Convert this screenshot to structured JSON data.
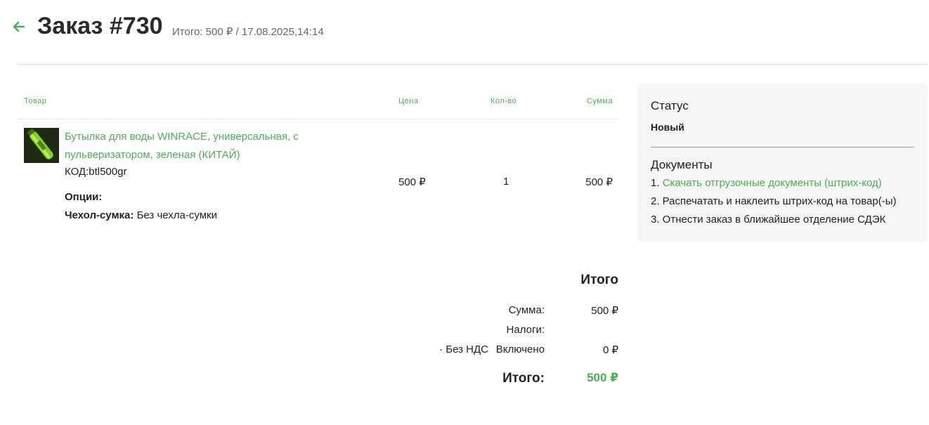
{
  "header": {
    "title": "Заказ #730",
    "subtitle": "Итого: 500 ₽ / 17.08.2025,14:14"
  },
  "colors": {
    "accent": "#4caf50",
    "panel_bg": "#f5f5f5"
  },
  "table": {
    "columns": [
      "Товар",
      "Цена",
      "Кол-во",
      "Сумма"
    ],
    "rows": [
      {
        "name": "Бутылка для воды WINRACE, универсальная, с пульверизатором, зеленая (КИТАЙ)",
        "code": "КОД:btl500gr",
        "options_label": "Опции:",
        "option_name": "Чехол-сумка:",
        "option_value": "Без чехла-сумки",
        "price": "500 ₽",
        "qty": "1",
        "sum": "500 ₽"
      }
    ]
  },
  "totals": {
    "title": "Итого",
    "sum_label": "Сумма:",
    "sum_value": "500 ₽",
    "taxes_label": "Налоги:",
    "tax_name": "· Без НДС",
    "tax_mode": "Включено",
    "tax_value": "0 ₽",
    "grand_label": "Итого:",
    "grand_value": "500 ₽"
  },
  "panel": {
    "status_heading": "Статус",
    "status_value": "Новый",
    "docs_heading": "Документы",
    "doc1_prefix": "1.",
    "doc1_link": "Скачать отгрузочные документы (штрих-код)",
    "doc2": "2. Распечатать и наклеить штрих-код на товар(-ы)",
    "doc3": "3. Отнести заказ в ближайшее отделение СДЭК"
  }
}
